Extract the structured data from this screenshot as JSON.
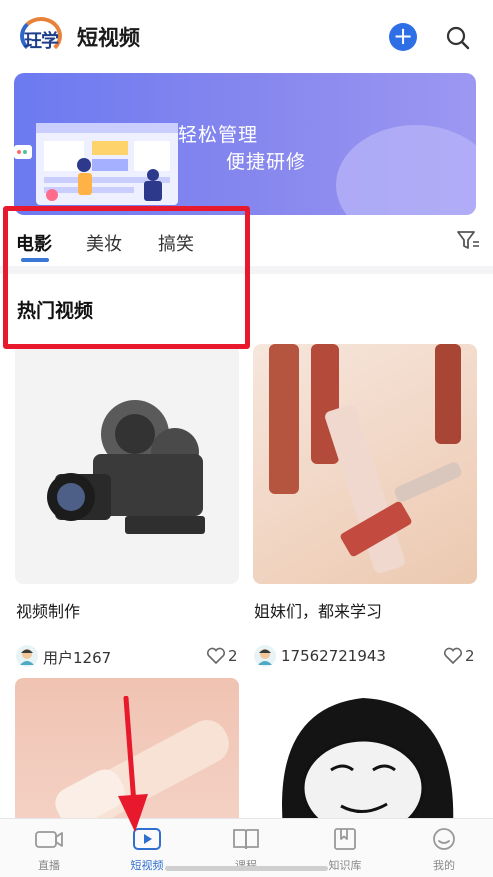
{
  "header": {
    "logo_text": "玨学",
    "title": "短视频"
  },
  "banner": {
    "line1": "轻松管理",
    "line2": "便捷研修"
  },
  "tabs": [
    {
      "label": "电影",
      "active": true
    },
    {
      "label": "美妆",
      "active": false
    },
    {
      "label": "搞笑",
      "active": false
    }
  ],
  "section_title": "热门视频",
  "cards": [
    {
      "title": "视频制作",
      "user": "用户1267",
      "likes": "2"
    },
    {
      "title": "姐妹们，都来学习",
      "user": "17562721943",
      "likes": "2"
    }
  ],
  "bottom_nav": [
    {
      "label": "直播",
      "icon": "camera-icon",
      "active": false
    },
    {
      "label": "短视频",
      "icon": "play-icon",
      "active": true
    },
    {
      "label": "课程",
      "icon": "book-icon",
      "active": false
    },
    {
      "label": "知识库",
      "icon": "bookmark-icon",
      "active": false
    },
    {
      "label": "我的",
      "icon": "smile-icon",
      "active": false
    }
  ],
  "colors": {
    "accent": "#2e6fe6",
    "highlight": "#e8192c",
    "banner": "#7b82f0"
  }
}
